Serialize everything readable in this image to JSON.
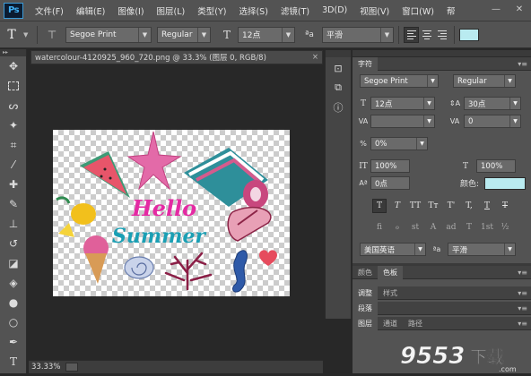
{
  "app": {
    "logo": "Ps"
  },
  "menu": {
    "items": [
      "文件(F)",
      "编辑(E)",
      "图像(I)",
      "图层(L)",
      "类型(Y)",
      "选择(S)",
      "滤镜(T)",
      "3D(D)",
      "视图(V)",
      "窗口(W)",
      "帮"
    ]
  },
  "window_controls": {
    "minimize": "—",
    "close": "✕"
  },
  "options": {
    "tool_icon": "T",
    "orient_icon": "⊤",
    "font_family": "Segoe Print",
    "font_style": "Regular",
    "size_icon": "T",
    "size": "12点",
    "aa_icon": "ªa",
    "antialias": "平滑",
    "text_color": "#b9ebf0"
  },
  "document": {
    "tab_title": "watercolour-4120925_960_720.png @ 33.3% (图层 0, RGB/8)",
    "tab_close": "×",
    "zoom_status": "33.33%",
    "hello_text": "Hello",
    "summer_text": "Summer"
  },
  "tools": {
    "icons": [
      "move-icon",
      "marquee-icon",
      "lasso-icon",
      "magic-wand-icon",
      "crop-icon",
      "eyedropper-icon",
      "healing-brush-icon",
      "brush-icon",
      "clone-stamp-icon",
      "history-brush-icon",
      "eraser-icon",
      "paint-bucket-icon",
      "blur-icon",
      "dodge-icon",
      "pen-icon",
      "type-icon"
    ]
  },
  "character_panel": {
    "tab_label": "字符",
    "font_family": "Segoe Print",
    "font_style": "Regular",
    "size": "12点",
    "leading": "30点",
    "kerning": "",
    "tracking": "0",
    "scale_pct": "0%",
    "vertical_scale": "100%",
    "horizontal_scale": "100%",
    "baseline": "0点",
    "color_label": "颜色:",
    "color": "#b9ebf0",
    "style_buttons": [
      "T",
      "T",
      "TT",
      "Tт",
      "T'",
      "T,",
      "T",
      "T"
    ],
    "opentype_buttons": [
      "fi",
      "ℴ",
      "st",
      "A",
      "ad",
      "T",
      "1st",
      "½"
    ],
    "language": "美国英语",
    "antialias_label": "ªa",
    "antialias": "平滑"
  },
  "panels": [
    {
      "tabs": [
        "颜色",
        "色板"
      ]
    },
    {
      "tabs": [
        "调整",
        "样式"
      ]
    },
    {
      "tabs": [
        "段落"
      ]
    },
    {
      "tabs": [
        "图层",
        "通道",
        "路径"
      ]
    }
  ],
  "watermark": {
    "brand": "9553",
    "suffix": "下载",
    "sub": ".com"
  }
}
